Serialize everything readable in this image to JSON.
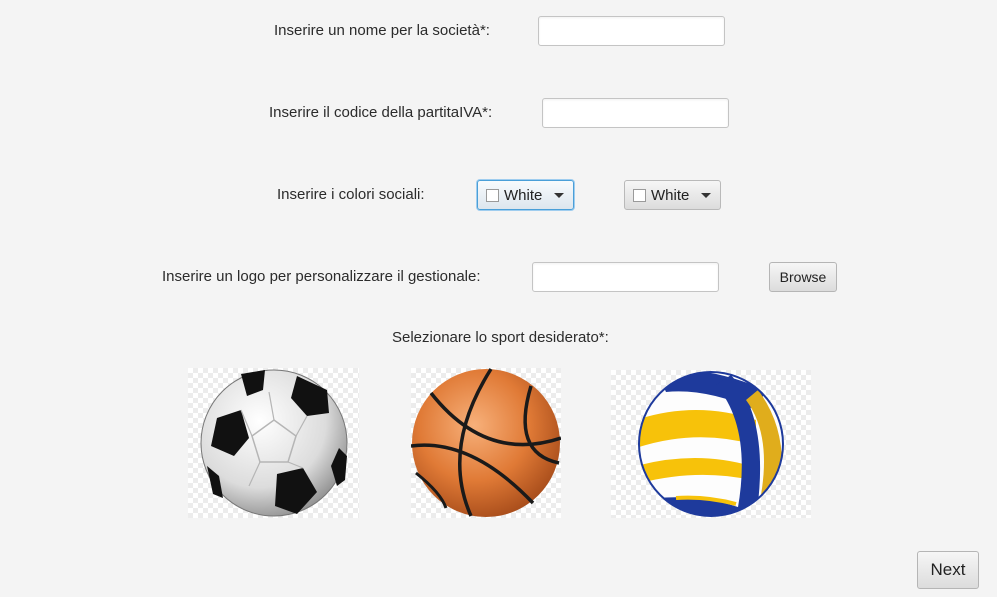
{
  "form": {
    "company_name_label": "Inserire un nome per la società*:",
    "company_name_value": "",
    "vat_label": "Inserire il codice della partitaIVA*:",
    "vat_value": "",
    "colors_label": "Inserire i colori sociali:",
    "color1_value": "White",
    "color2_value": "White",
    "logo_label": "Inserire un logo per personalizzare il gestionale:",
    "logo_path_value": "",
    "browse_label": "Browse",
    "sport_label": "Selezionare lo sport desiderato*:"
  },
  "sports": [
    {
      "icon": "soccer-ball-icon"
    },
    {
      "icon": "basketball-icon"
    },
    {
      "icon": "volleyball-icon"
    }
  ],
  "footer": {
    "next_label": "Next"
  },
  "colors": {
    "focus_border": "#4a9fd8",
    "background": "#f4f4f4"
  }
}
